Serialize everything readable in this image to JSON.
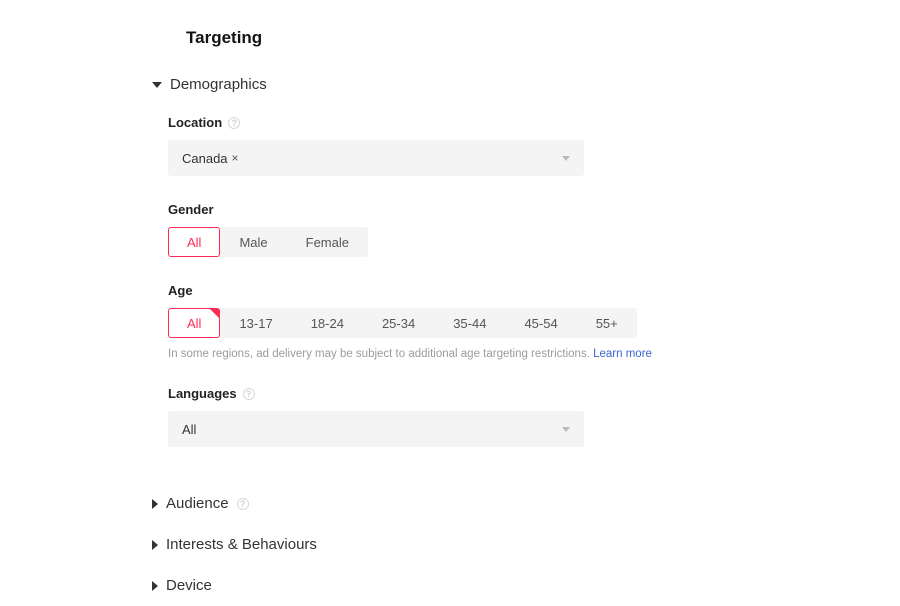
{
  "title": "Targeting",
  "accent": "#fe2c55",
  "demographics": {
    "heading": "Demographics",
    "location": {
      "label": "Location",
      "value": "Canada"
    },
    "gender": {
      "label": "Gender",
      "options": [
        "All",
        "Male",
        "Female"
      ],
      "selected": "All"
    },
    "age": {
      "label": "Age",
      "options": [
        "All",
        "13-17",
        "18-24",
        "25-34",
        "35-44",
        "45-54",
        "55+"
      ],
      "selected": "All",
      "hint": "In some regions, ad delivery may be subject to additional age targeting restrictions.",
      "learn_more": "Learn more"
    },
    "languages": {
      "label": "Languages",
      "value": "All"
    }
  },
  "sections": {
    "audience": "Audience",
    "interests": "Interests & Behaviours",
    "device": "Device"
  }
}
